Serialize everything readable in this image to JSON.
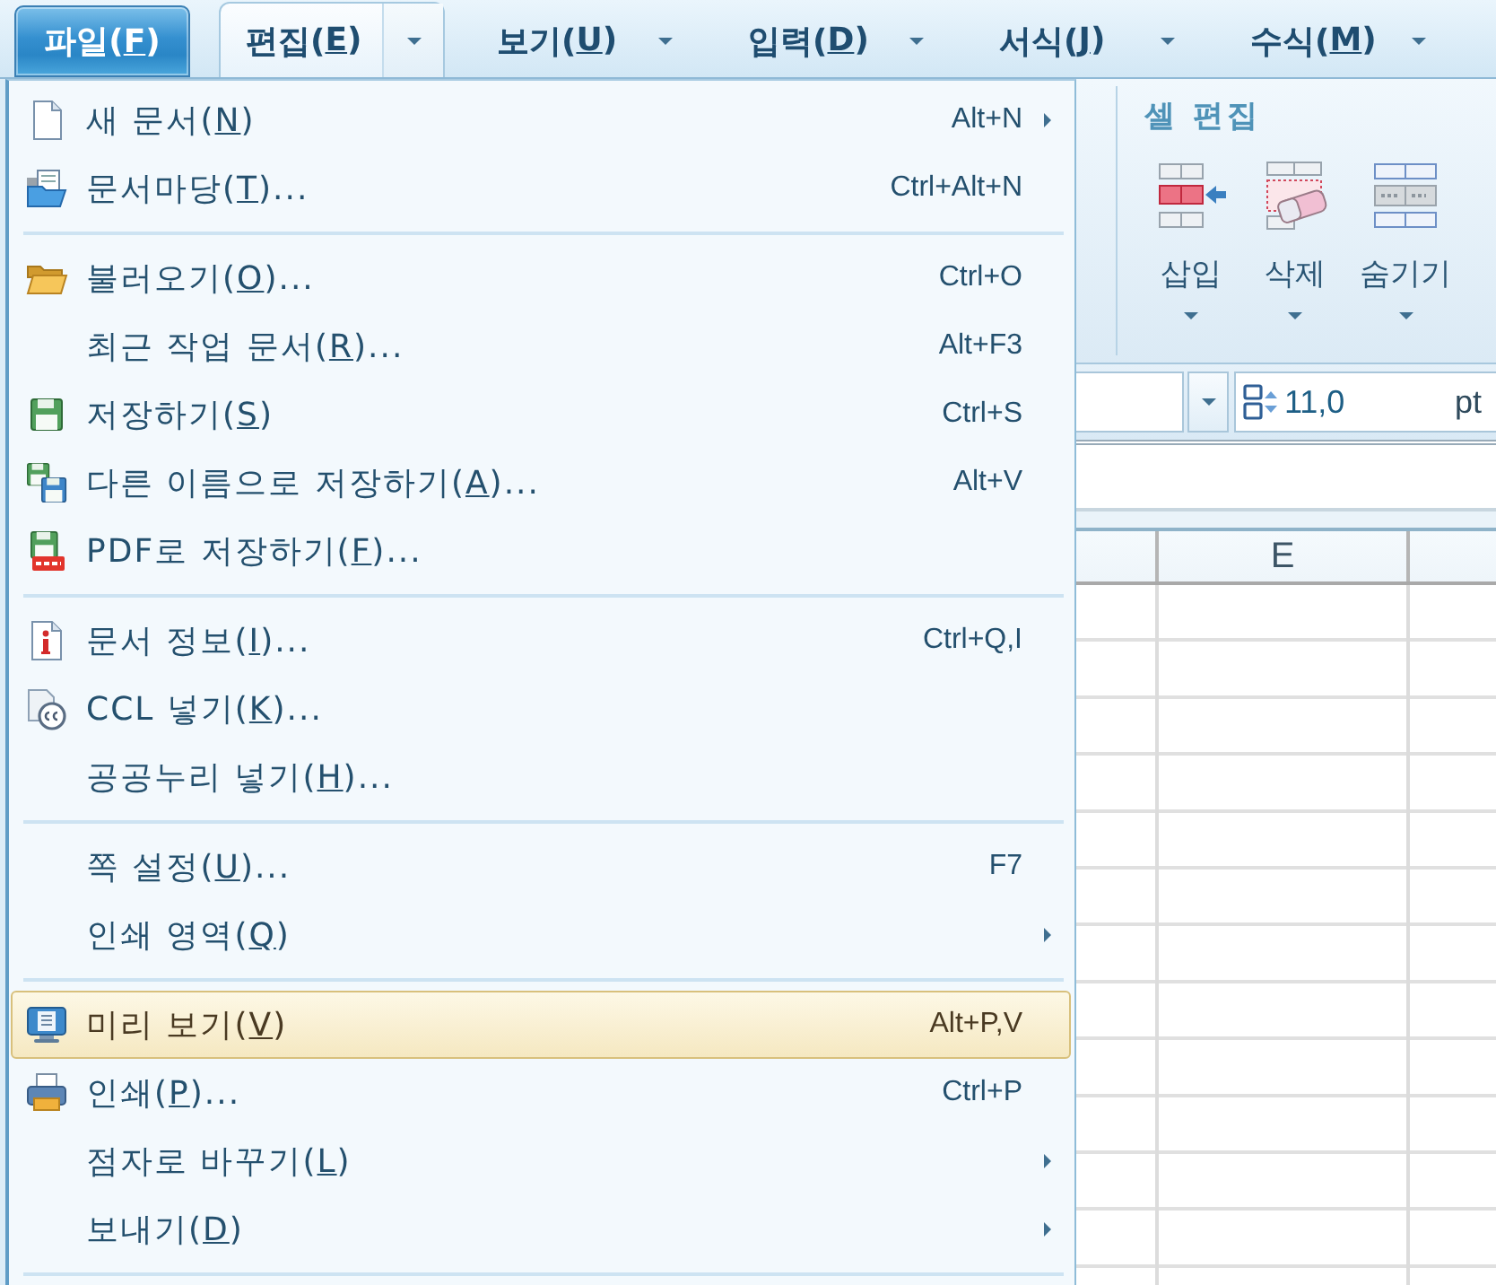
{
  "menubar": {
    "file_button": {
      "label": "파일(F)",
      "open": true
    },
    "tabs": [
      {
        "label": "편집(E)",
        "selected": true,
        "dropdown": true
      },
      {
        "label": "보기(U)",
        "selected": false,
        "dropdown": true
      },
      {
        "label": "입력(D)",
        "selected": false,
        "dropdown": true
      },
      {
        "label": "서식(J)",
        "selected": false,
        "dropdown": true
      },
      {
        "label": "수식(M)",
        "selected": false,
        "dropdown": true
      }
    ]
  },
  "file_menu": {
    "sections": [
      {
        "items": [
          {
            "kind": "new",
            "label": "새 문서(N)",
            "shortcut": "Alt+N",
            "submenu": true,
            "highlighted": false
          },
          {
            "kind": "template",
            "label": "문서마당(T)...",
            "shortcut": "Ctrl+Alt+N",
            "submenu": false,
            "highlighted": false
          }
        ]
      },
      {
        "items": [
          {
            "kind": "open",
            "label": "불러오기(O)...",
            "shortcut": "Ctrl+O",
            "submenu": false,
            "highlighted": false
          },
          {
            "label": "최근 작업 문서(R)...",
            "shortcut": "Alt+F3",
            "submenu": false,
            "highlighted": false
          },
          {
            "kind": "save",
            "label": "저장하기(S)",
            "shortcut": "Ctrl+S",
            "submenu": false,
            "highlighted": false
          },
          {
            "kind": "save_as",
            "label": "다른 이름으로 저장하기(A)...",
            "shortcut": "Alt+V",
            "submenu": false,
            "highlighted": false
          },
          {
            "kind": "export_pdf",
            "label": "PDF로 저장하기(F)...",
            "submenu": false,
            "highlighted": false
          }
        ]
      },
      {
        "items": [
          {
            "kind": "info",
            "label": "문서 정보(I)...",
            "shortcut": "Ctrl+Q,I",
            "submenu": false,
            "highlighted": false
          },
          {
            "kind": "license",
            "label": "CCL 넣기(K)...",
            "submenu": false,
            "highlighted": false
          },
          {
            "label": "공공누리 넣기(H)...",
            "submenu": false,
            "highlighted": false
          }
        ]
      },
      {
        "items": [
          {
            "label": "쪽 설정(U)...",
            "shortcut": "F7",
            "submenu": false,
            "highlighted": false
          },
          {
            "label": "인쇄 영역(Q)",
            "submenu": true,
            "highlighted": false
          }
        ]
      },
      {
        "items": [
          {
            "kind": "preview",
            "label": "미리 보기(V)",
            "shortcut": "Alt+P,V",
            "submenu": false,
            "highlighted": true
          },
          {
            "kind": "print",
            "label": "인쇄(P)...",
            "shortcut": "Ctrl+P",
            "submenu": false,
            "highlighted": false
          },
          {
            "label": "점자로 바꾸기(L)",
            "submenu": true,
            "highlighted": false
          },
          {
            "label": "보내기(D)",
            "submenu": true,
            "highlighted": false
          }
        ]
      }
    ]
  },
  "ribbon": {
    "groups": [
      {
        "title": "셀 편집",
        "buttons": [
          {
            "kind": "insert",
            "label": "삽입",
            "dropdown": true
          },
          {
            "kind": "delete",
            "label": "삭제",
            "dropdown": true
          },
          {
            "kind": "hide",
            "label": "숨기기",
            "dropdown": true
          }
        ]
      }
    ]
  },
  "toolbar": {
    "font_size": {
      "value": "11,0",
      "unit": "pt"
    }
  },
  "sheet": {
    "columns": [
      {
        "label": "E"
      }
    ]
  }
}
